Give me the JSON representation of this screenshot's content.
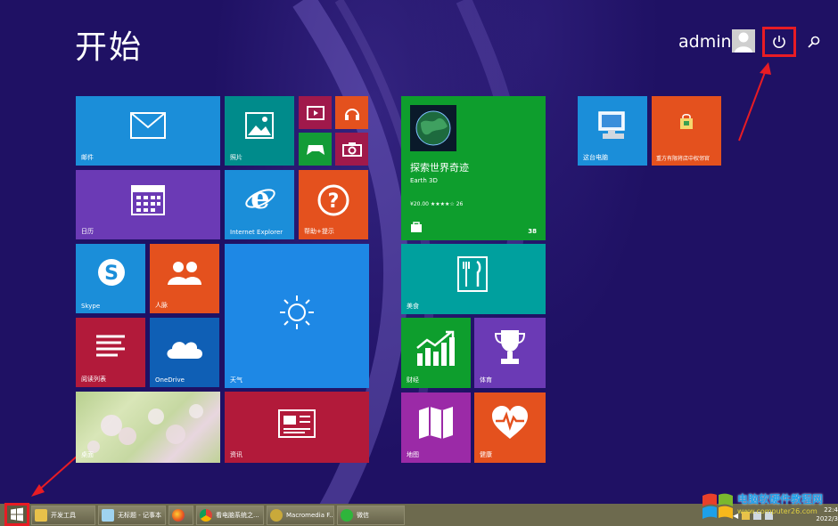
{
  "start_screen": {
    "title": "开始",
    "user": {
      "name": "admin"
    }
  },
  "tiles": {
    "mail": {
      "label": "邮件",
      "color": "#1b8ed9"
    },
    "photos": {
      "label": "照片",
      "color": "#008b8b"
    },
    "video": {
      "color": "#a0194b"
    },
    "music": {
      "color": "#e4511e"
    },
    "games": {
      "color": "#139c37"
    },
    "camera": {
      "color": "#a0194b"
    },
    "calendar": {
      "label": "日历",
      "color": "#6b3ab5"
    },
    "ie": {
      "label": "Internet Explorer",
      "color": "#1b8ed9"
    },
    "help": {
      "label": "帮助+提示",
      "color": "#e4511e"
    },
    "skype": {
      "label": "Skype",
      "color": "#1b8ed9"
    },
    "people": {
      "label": "人脉",
      "color": "#e4511e"
    },
    "weather": {
      "label": "天气",
      "color": "#1e88e5"
    },
    "reading": {
      "label": "阅读列表",
      "color": "#b21a3a"
    },
    "onedrive": {
      "label": "OneDrive",
      "color": "#0f5fb5"
    },
    "desktop": {
      "label": "桌面"
    },
    "news": {
      "label": "资讯",
      "color": "#b21a3a"
    },
    "earth3d": {
      "title": "探索世界奇迹",
      "app": "Earth 3D",
      "rating": "¥20.00 ★★★★☆ 26",
      "badge": "38",
      "color": "#0e9e2d"
    },
    "food": {
      "label": "美食",
      "color": "#00a09e"
    },
    "finance": {
      "label": "财经",
      "color": "#0e9e2d"
    },
    "sports": {
      "label": "体育",
      "color": "#6b3ab5"
    },
    "maps": {
      "label": "地图",
      "color": "#9b2aa7"
    },
    "health": {
      "label": "健康",
      "color": "#e4511e"
    },
    "this_pc": {
      "label": "这台电脑",
      "color": "#1b8ed9"
    },
    "store_tile": {
      "label": "重方有限将店中权邻官",
      "color": "#e4511e"
    }
  },
  "taskbar": {
    "items": [
      {
        "label": "开发工具"
      },
      {
        "label": "无标题 - 记事本"
      },
      {
        "label": ""
      },
      {
        "label": "看电脑系统之..."
      },
      {
        "label": "Macromedia F..."
      },
      {
        "label": "微信"
      }
    ],
    "time": "22:4",
    "date": "2022/3"
  },
  "watermark": {
    "title": "电脑软硬件教程网",
    "url": "www.computer26.com"
  },
  "colors": {
    "background": "#1f1164",
    "highlight": "#e81c24"
  }
}
